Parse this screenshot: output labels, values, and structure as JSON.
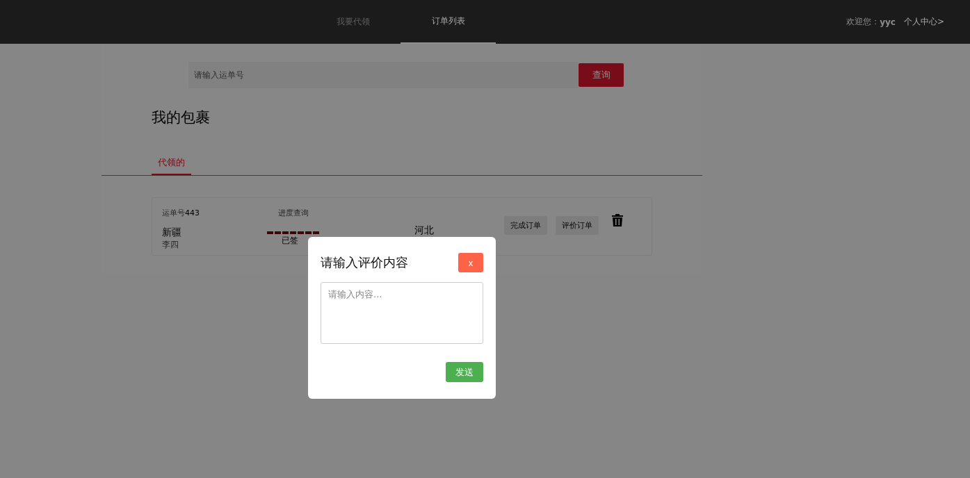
{
  "nav": {
    "tabs": [
      {
        "label": "我要代领",
        "selected": false
      },
      {
        "label": "订单列表",
        "selected": true
      }
    ],
    "welcome": "欢迎您：",
    "username": "yyc",
    "profile_link": "个人中心>"
  },
  "search": {
    "placeholder": "请输入运单号",
    "button": "查询"
  },
  "heading": "我的包裹",
  "section_tabs": [
    {
      "label": "代领的",
      "selected": true
    }
  ],
  "order": {
    "number_label": "运单号",
    "number": "443",
    "progress_label": "进度查询",
    "from": "新疆",
    "recipient": "李四",
    "status": "已签",
    "to": "河北",
    "buttons": [
      "完成订单",
      "评价订单"
    ]
  },
  "dialog": {
    "title": "请输入评价内容",
    "close": "x",
    "placeholder": "请输入内容...",
    "send": "发送"
  }
}
